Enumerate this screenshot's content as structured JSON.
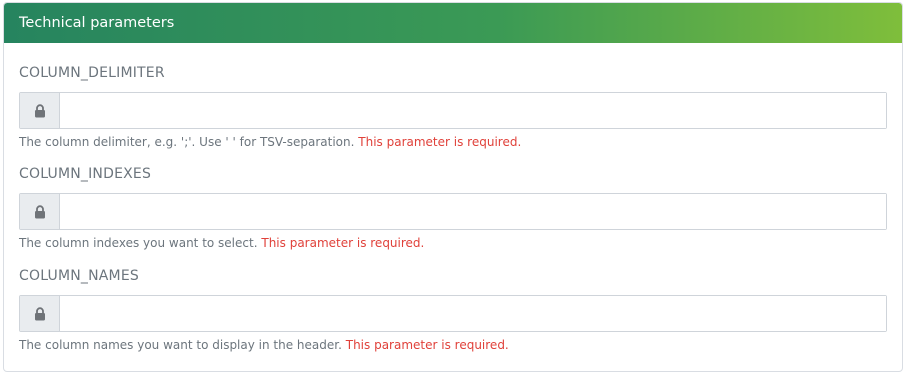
{
  "panel": {
    "title": "Technical parameters"
  },
  "params": [
    {
      "label": "COLUMN_DELIMITER",
      "value": "",
      "help": "The column delimiter, e.g. ';'. Use ' ' for TSV-separation.",
      "required_text": "This parameter is required."
    },
    {
      "label": "COLUMN_INDEXES",
      "value": "",
      "help": "The column indexes you want to select.",
      "required_text": "This parameter is required."
    },
    {
      "label": "COLUMN_NAMES",
      "value": "",
      "help": "The column names you want to display in the header.",
      "required_text": "This parameter is required."
    }
  ],
  "icons": {
    "field_addon": "lock-icon"
  },
  "colors": {
    "header_gradient_start": "#26845f",
    "header_gradient_end": "#7fbe3b",
    "required_text": "#e0413a",
    "help_text": "#6c757d"
  }
}
